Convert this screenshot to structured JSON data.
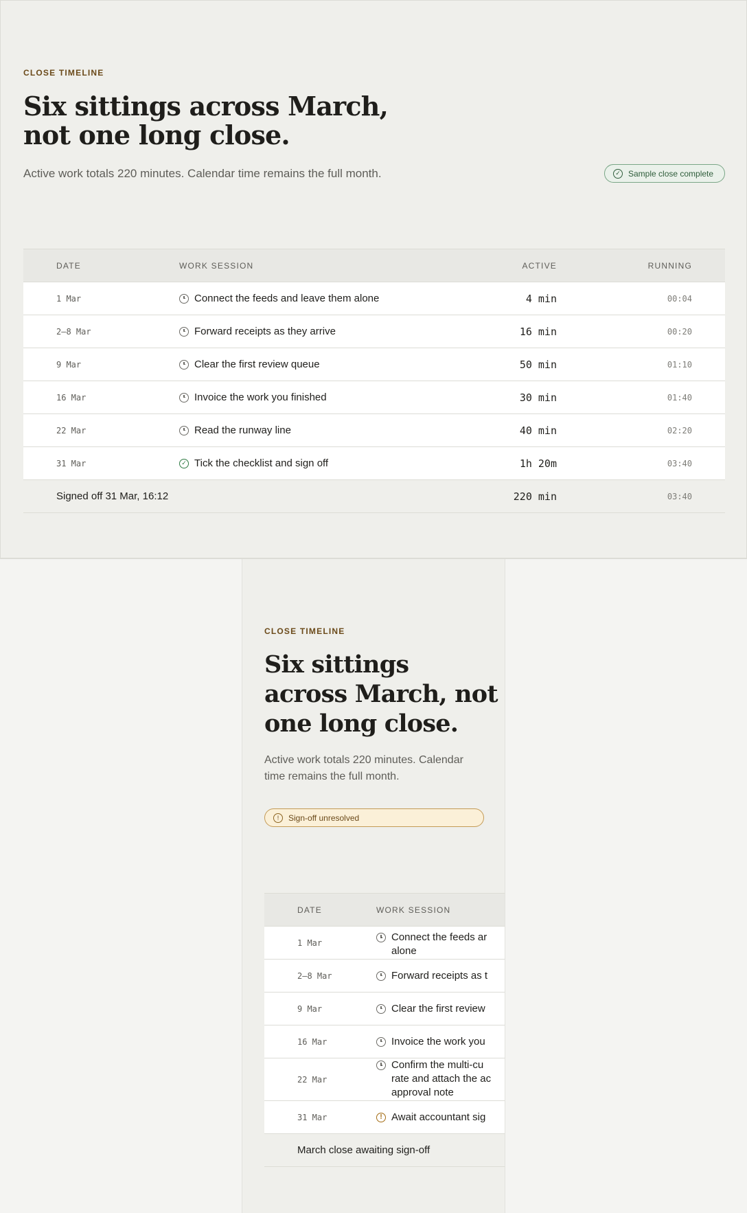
{
  "desktop": {
    "eyebrow": "CLOSE TIMELINE",
    "headline_line1": "Six sittings across March,",
    "headline_line2": "not one long close.",
    "subtitle": "Active work totals 220 minutes. Calendar time remains the full month.",
    "badge": {
      "label": "Sample close complete",
      "icon": "check-circle-icon",
      "color": "#2f5d3b"
    },
    "table": {
      "headers": {
        "date": "DATE",
        "session": "WORK SESSION",
        "active": "ACTIVE",
        "running": "RUNNING"
      },
      "rows": [
        {
          "date": "1 Mar",
          "session": "Connect the feeds and leave them alone",
          "active": "4 min",
          "running": "00:04",
          "icon": "clock-icon"
        },
        {
          "date": "2–8 Mar",
          "session": "Forward receipts as they arrive",
          "active": "16 min",
          "running": "00:20",
          "icon": "clock-icon"
        },
        {
          "date": "9 Mar",
          "session": "Clear the first review queue",
          "active": "50 min",
          "running": "01:10",
          "icon": "clock-icon"
        },
        {
          "date": "16 Mar",
          "session": "Invoice the work you finished",
          "active": "30 min",
          "running": "01:40",
          "icon": "clock-icon"
        },
        {
          "date": "22 Mar",
          "session": "Read the runway line",
          "active": "40 min",
          "running": "02:20",
          "icon": "clock-icon"
        },
        {
          "date": "31 Mar",
          "session": "Tick the checklist and sign off",
          "active": "1h 20m",
          "running": "03:40",
          "icon": "check-circle-icon"
        }
      ],
      "footer": {
        "label": "Signed off 31 Mar, 16:12",
        "active": "220 min",
        "running": "03:40"
      }
    }
  },
  "mobile": {
    "eyebrow": "CLOSE TIMELINE",
    "headline_line1": "Six sittings",
    "headline_line2": "across March, not",
    "headline_line3": "one long close.",
    "subtitle_line1": "Active work totals 220 minutes. Calendar",
    "subtitle_line2": "time remains the full month.",
    "badge": {
      "label": "Sign-off unresolved",
      "icon": "warning-circle-icon",
      "color": "#6b4a1a"
    },
    "table": {
      "headers": {
        "date": "DATE",
        "session": "WORK SESSION"
      },
      "rows": [
        {
          "date": "1 Mar",
          "session_line1": "Connect the feeds ar",
          "session_line2": "alone",
          "icon": "clock-icon"
        },
        {
          "date": "2–8 Mar",
          "session_line1": "Forward receipts as t",
          "icon": "clock-icon"
        },
        {
          "date": "9 Mar",
          "session_line1": "Clear the first review",
          "icon": "clock-icon"
        },
        {
          "date": "16 Mar",
          "session_line1": "Invoice the work you",
          "icon": "clock-icon"
        },
        {
          "date": "22 Mar",
          "session_line1": "Confirm the multi-cu",
          "session_line2": "rate and attach the ac",
          "session_line3": "approval note",
          "icon": "clock-icon"
        },
        {
          "date": "31 Mar",
          "session_line1": "Await accountant sig",
          "icon": "warning-circle-icon"
        }
      ],
      "footer": {
        "label": "March close awaiting sign-off"
      }
    }
  }
}
